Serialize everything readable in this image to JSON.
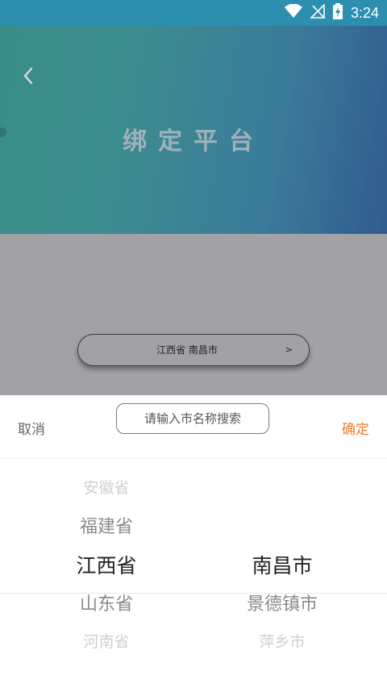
{
  "status_bar": {
    "time": "3:24"
  },
  "header": {
    "title": "绑定平台"
  },
  "selector": {
    "value": "江西省 南昌市",
    "arrow": ">"
  },
  "picker": {
    "cancel_label": "取消",
    "confirm_label": "确定",
    "search_placeholder": "请输入市名称搜索",
    "provinces": [
      "安徽省",
      "福建省",
      "江西省",
      "山东省",
      "河南省"
    ],
    "cities": [
      "南昌市",
      "景德镇市",
      "萍乡市"
    ],
    "selected_province": "江西省",
    "selected_city": "南昌市"
  },
  "colors": {
    "accent": "#f07f2e",
    "status_bar": "#2d8fb0"
  }
}
